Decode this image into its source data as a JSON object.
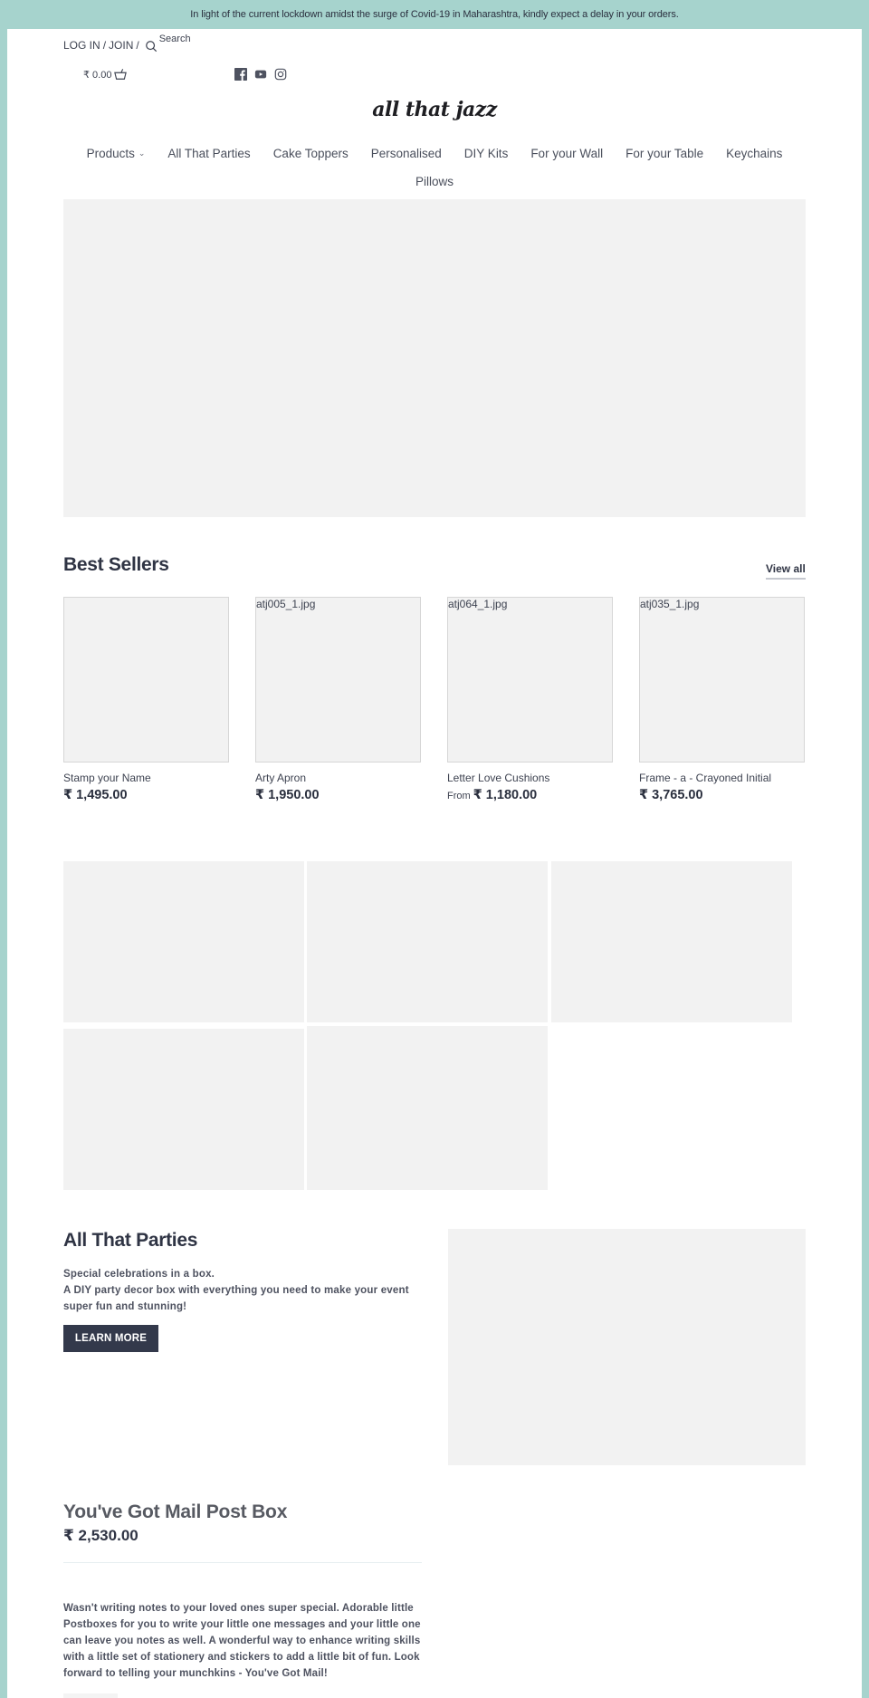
{
  "announcement": "In light of the current lockdown amidst the surge of Covid-19 in Maharashtra, kindly expect a delay in your orders.",
  "colors": {
    "announcement_bg": "#a6d3cd",
    "primary_dark": "#33394b",
    "placeholder_gray": "#f2f2f2"
  },
  "header": {
    "login_label": "LOG IN",
    "join_label": "JOIN",
    "separator": "/",
    "search_label": "Search",
    "cart_total": "₹ 0.00",
    "icons": {
      "search": "search-icon",
      "cart": "basket-icon",
      "facebook": "facebook-icon",
      "youtube": "youtube-icon",
      "instagram": "instagram-icon"
    }
  },
  "logo": "all that jazz",
  "nav": {
    "items": [
      {
        "label": "Products",
        "has_dropdown": true
      },
      {
        "label": "All That Parties"
      },
      {
        "label": "Cake Toppers"
      },
      {
        "label": "Personalised"
      },
      {
        "label": "DIY Kits"
      },
      {
        "label": "For your Wall"
      },
      {
        "label": "For your Table"
      },
      {
        "label": "Keychains"
      },
      {
        "label": "Pillows"
      }
    ],
    "dropdown_glyph": "⌄"
  },
  "best_sellers": {
    "title": "Best Sellers",
    "view_all": "View all",
    "products": [
      {
        "image_alt": "",
        "name": "Stamp your Name",
        "price_prefix": "",
        "price": "₹ 1,495.00"
      },
      {
        "image_alt": "atj005_1.jpg",
        "name": "Arty Apron",
        "price_prefix": "",
        "price": "₹ 1,950.00"
      },
      {
        "image_alt": "atj064_1.jpg",
        "name": "Letter Love Cushions",
        "price_prefix": "From",
        "price": "₹ 1,180.00"
      },
      {
        "image_alt": "atj035_1.jpg",
        "name": "Frame - a - Crayoned Initial",
        "price_prefix": "",
        "price": "₹ 3,765.00"
      }
    ]
  },
  "all_that_parties": {
    "title": "All That Parties",
    "line1": "Special celebrations in a box.",
    "line2": "A DIY party decor box with everything you need to make your event super fun and stunning!",
    "button": "LEARN MORE"
  },
  "featured_product": {
    "title": "You've Got Mail Post Box",
    "price": "₹ 2,530.00",
    "description": "Wasn't writing notes to your loved ones super special. Adorable little Postboxes for you to write your little one messages and your little one can leave you notes as well. A wonderful way to enhance writing skills with a little set of stationery and stickers to add a little bit of fun. Look forward to telling your munchkins - You've Got Mail!"
  }
}
